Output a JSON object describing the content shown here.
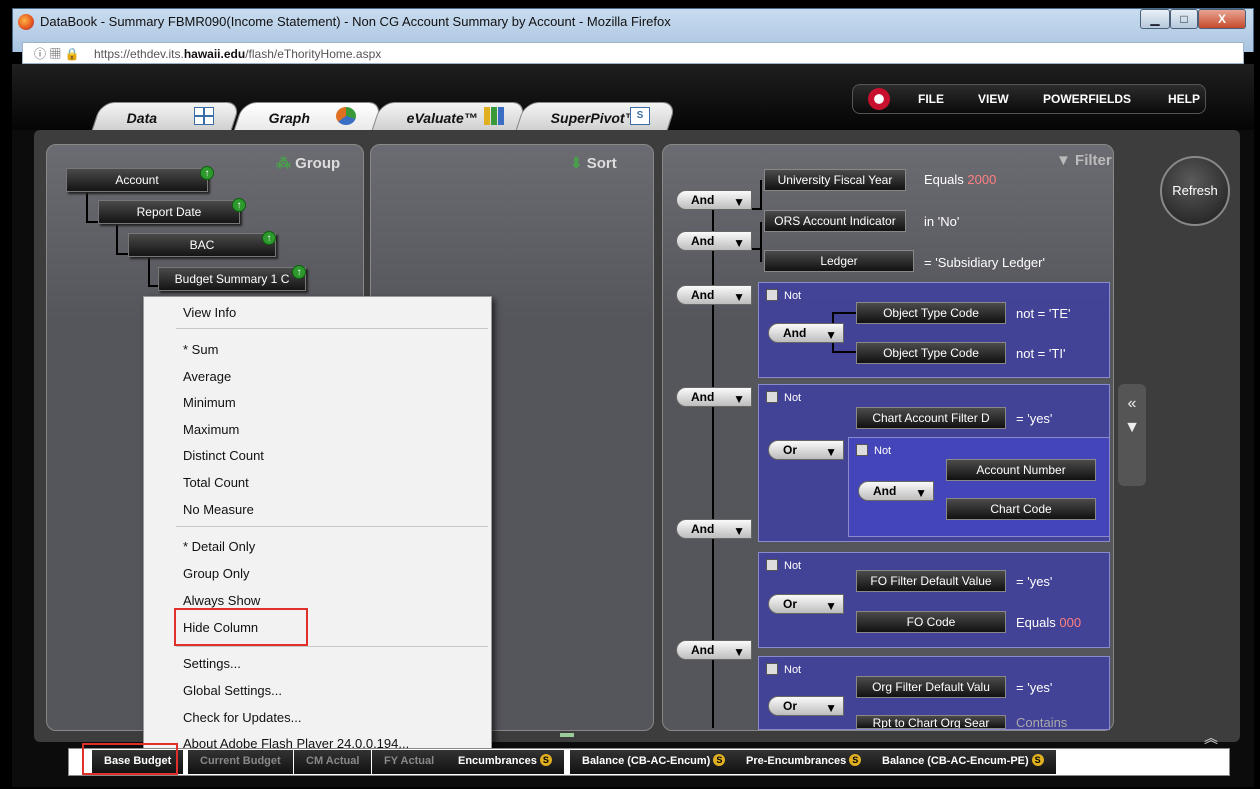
{
  "window": {
    "title": "DataBook - Summary FBMR090(Income Statement) - Non CG Account Summary by Account - Mozilla Firefox",
    "controls": {
      "minimize": "▁",
      "maximize": "□",
      "close": "X"
    }
  },
  "urlbar": {
    "prefix": "https://ethdev.its.",
    "domain": "hawaii.edu",
    "suffix": "/flash/eThorityHome.aspx"
  },
  "tabs": [
    {
      "label": "Data",
      "icon": "table-icon"
    },
    {
      "label": "Graph",
      "icon": "pie-chart-icon"
    },
    {
      "label": "eValuate™",
      "icon": "bar-chart-icon"
    },
    {
      "label": "SuperPivot™",
      "icon": "pivot-icon"
    }
  ],
  "menu": {
    "file": "FILE",
    "view": "VIEW",
    "powerfields": "POWERFIELDS",
    "help": "HELP"
  },
  "refresh_label": "Refresh",
  "group_panel": {
    "title": "Group",
    "items": [
      "Account",
      "Report Date",
      "BAC",
      "Budget Summary 1 C"
    ]
  },
  "sort_panel": {
    "title": "Sort"
  },
  "filter_panel": {
    "title": "Filter",
    "row1": {
      "field": "University Fiscal Year",
      "op": "Equals",
      "value": "2000"
    },
    "row2": {
      "field": "ORS Account Indicator",
      "op": "in",
      "value": "'No'"
    },
    "row3": {
      "field": "Ledger",
      "op": "=",
      "value": "'Subsidiary Ledger'"
    },
    "row4a": {
      "field": "Object Type Code",
      "op": "not =",
      "value": "'TE'"
    },
    "row4b": {
      "field": "Object Type Code",
      "op": "not =",
      "value": "'TI'"
    },
    "row5": {
      "field": "Chart Account Filter D",
      "op": "=",
      "value": "'yes'"
    },
    "row5a": {
      "field": "Account Number"
    },
    "row5b": {
      "field": "Chart Code"
    },
    "row6a": {
      "field": "FO Filter Default Value",
      "op": "=",
      "value": "'yes'"
    },
    "row6b": {
      "field": "FO Code",
      "op": "Equals",
      "value": "000"
    },
    "row7a": {
      "field": "Org Filter Default Valu",
      "op": "=",
      "value": "'yes'"
    },
    "row7b": {
      "field": "Rpt to Chart Org Sear",
      "op": "Contains"
    },
    "and": "And",
    "or": "Or",
    "not": "Not"
  },
  "context_menu": {
    "view_info": "View Info",
    "sum": "* Sum",
    "average": "Average",
    "minimum": "Minimum",
    "maximum": "Maximum",
    "distinct_count": "Distinct Count",
    "total_count": "Total Count",
    "no_measure": "No Measure",
    "detail_only": "* Detail Only",
    "group_only": "Group Only",
    "always_show": "Always Show",
    "hide_column": "Hide Column",
    "settings": "Settings...",
    "global_settings": "Global Settings...",
    "check_updates": "Check for Updates...",
    "about": "About Adobe Flash Player 24.0.0.194..."
  },
  "bottom_tabs": [
    "Base Budget",
    "Current Budget",
    "CM Actual",
    "FY Actual",
    "Encumbrances",
    "Balance (CB-AC-Encum)",
    "Pre-Encumbrances",
    "Balance (CB-AC-Encum-PE)"
  ],
  "badge_letter": "S",
  "colors": {
    "highlight": "#e0302a",
    "filter_value": "#ff8080",
    "group_bg": "#4a4aaa"
  }
}
